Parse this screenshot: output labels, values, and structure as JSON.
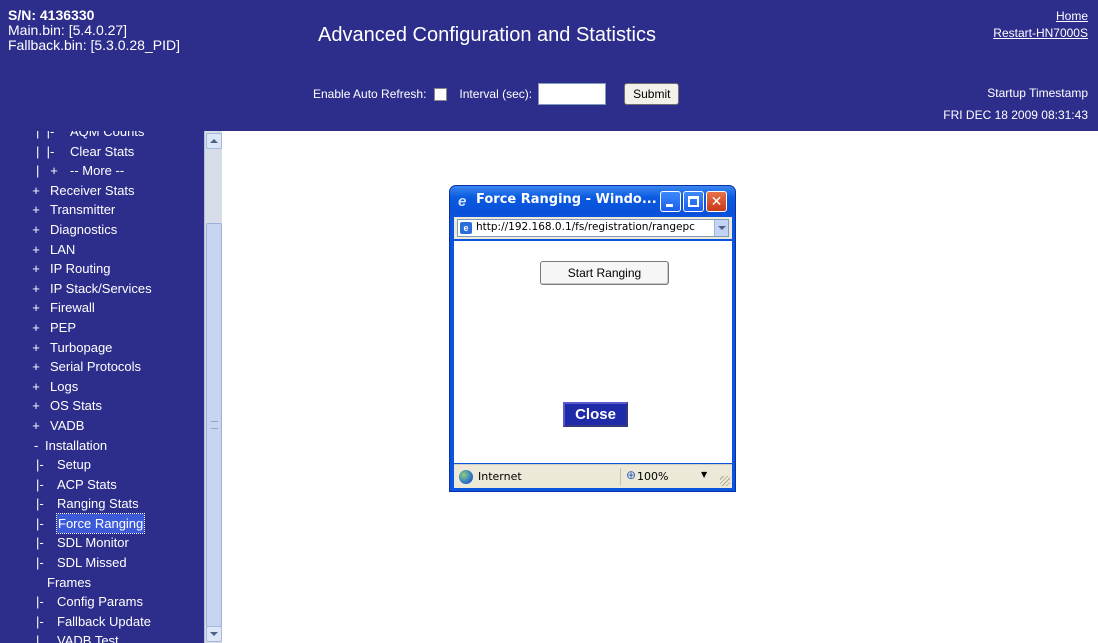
{
  "header": {
    "serial": "S/N: 4136330",
    "main_bin": "Main.bin: [5.4.0.27]",
    "fallback_bin": "Fallback.bin: [5.3.0.28_PID]",
    "title": "Advanced Configuration and Statistics",
    "links": {
      "home": "Home",
      "restart": "Restart-HN7000S"
    },
    "auto_refresh_label": "Enable Auto Refresh:",
    "interval_label": "Interval (sec):",
    "interval_value": "",
    "submit_label": "Submit",
    "startup_label": "Startup Timestamp",
    "startup_value": "FRI DEC 18 2009 08:31:43"
  },
  "sidebar": {
    "tree_items": [
      {
        "label": "AQM Counts"
      },
      {
        "label": "Clear Stats"
      },
      {
        "label": "-- More --"
      }
    ],
    "sections": [
      "Receiver Stats",
      "Transmitter",
      "Diagnostics",
      "LAN",
      "IP Routing",
      "IP Stack/Services",
      "Firewall",
      "PEP",
      "Turbopage",
      "Serial Protocols",
      "Logs",
      "OS Stats",
      "VADB"
    ],
    "expanded_section": "Installation",
    "installation_items": [
      "Setup",
      "ACP Stats",
      "Ranging Stats",
      "Force Ranging",
      "SDL Monitor",
      "SDL Missed",
      "Frames",
      "Config Params",
      "Fallback Update",
      "VADB Test"
    ],
    "selected_item": "Force Ranging",
    "glyphs": {
      "plus": "+",
      "minus": "-",
      "branch": "|-",
      "pipe": "|"
    }
  },
  "popup": {
    "title": "Force Ranging - Windo...",
    "address": "http://192.168.0.1/fs/registration/rangepc",
    "start_button": "Start Ranging",
    "close_button": "Close",
    "zone": "Internet",
    "zoom": "100%"
  },
  "colors": {
    "background_blue": "#2d2e8c",
    "selection_blue": "#3d5bd9",
    "xp_title_blue": "#0b54e0",
    "close_button_blue": "#1f2aa8"
  }
}
